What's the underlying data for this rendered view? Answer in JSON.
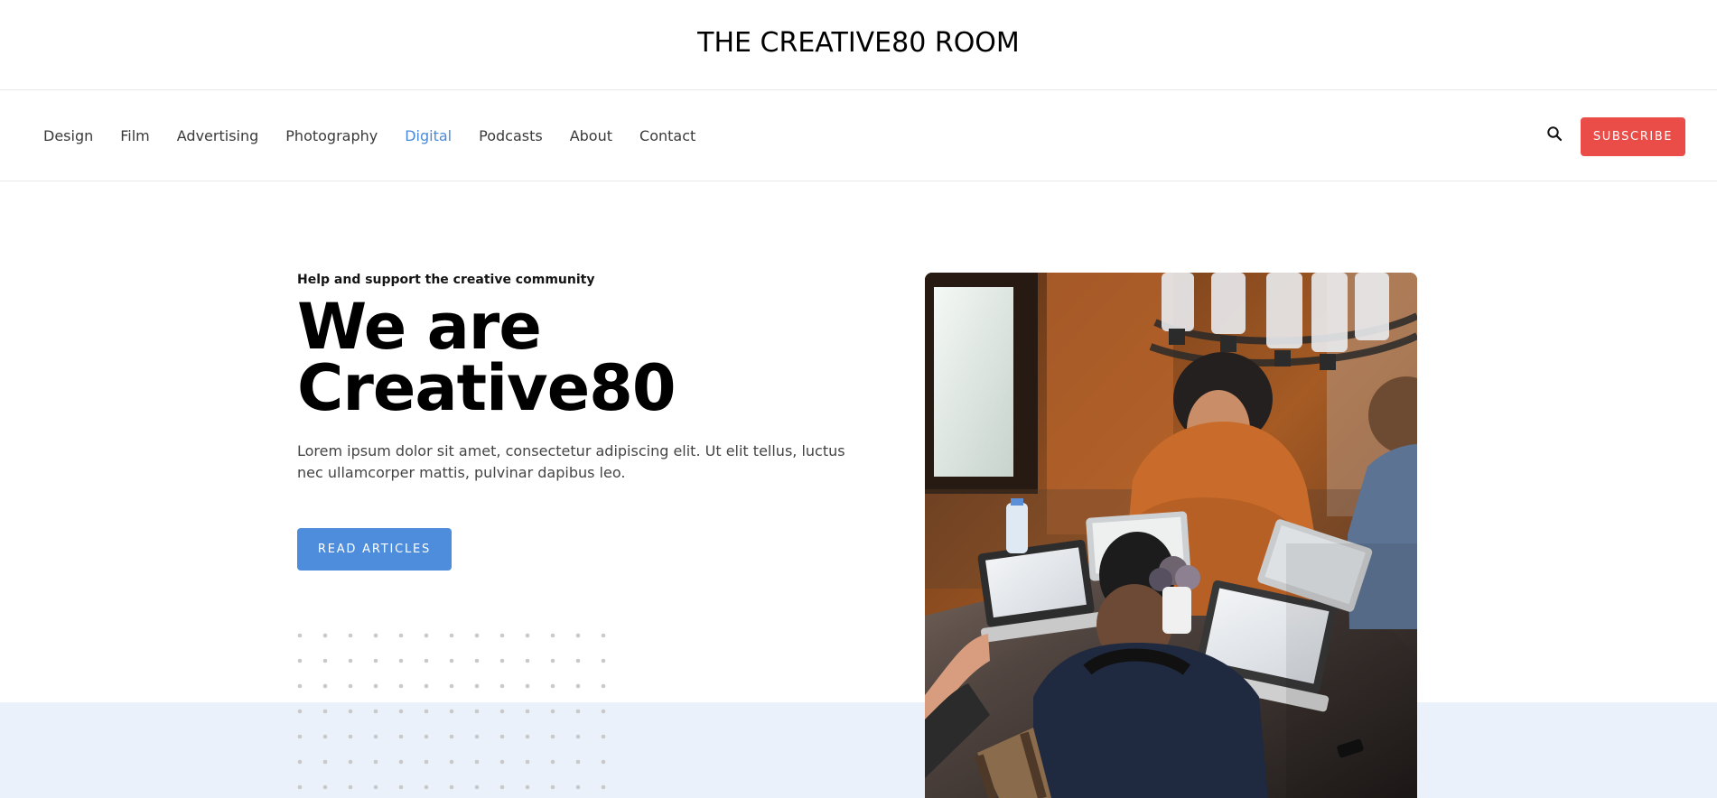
{
  "header": {
    "site_title": "THE CREATIVE80 ROOM"
  },
  "nav": {
    "items": [
      {
        "label": "Design"
      },
      {
        "label": "Film"
      },
      {
        "label": "Advertising"
      },
      {
        "label": "Photography"
      },
      {
        "label": "Digital",
        "active": true
      },
      {
        "label": "Podcasts"
      },
      {
        "label": "About"
      },
      {
        "label": "Contact"
      }
    ],
    "search_icon": "search-icon",
    "subscribe_label": "SUBSCRIBE"
  },
  "hero": {
    "eyebrow": "Help and support the creative community",
    "title_line_1": "We are",
    "title_line_2": "Creative80",
    "body": "Lorem ipsum dolor sit amet, consectetur adipiscing elit. Ut elit tellus, luctus nec ullamcorper mattis, pulvinar dapibus leo.",
    "button_label": "READ ARTICLES"
  },
  "colors": {
    "accent_blue": "#4d8ddb",
    "subscribe_red": "#ea4c48",
    "hero_band": "#ebf1fb"
  },
  "image": {
    "description": "group-working-on-laptops-photo"
  }
}
